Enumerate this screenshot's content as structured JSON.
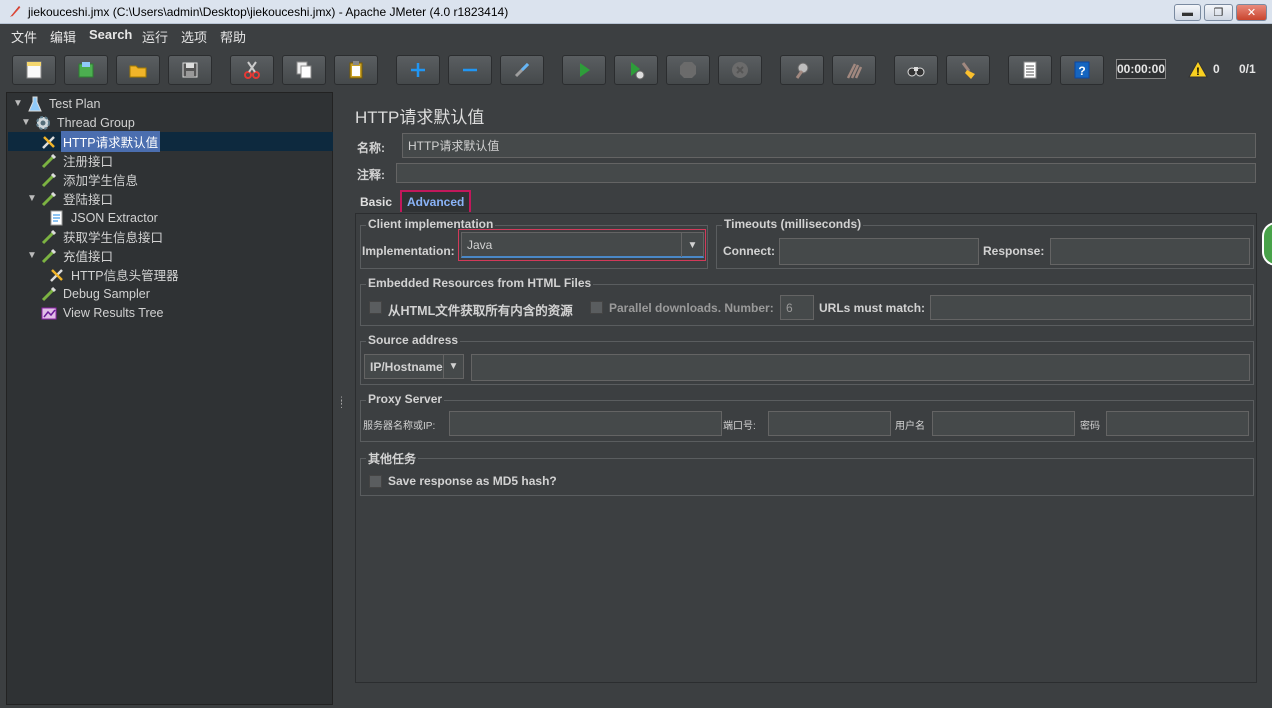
{
  "window": {
    "title": "jiekouceshi.jmx (C:\\Users\\admin\\Desktop\\jiekouceshi.jmx) - Apache JMeter (4.0 r1823414)",
    "minimize": "▬",
    "restore": "❐",
    "close": "✕"
  },
  "menu": [
    "文件",
    "编辑",
    "Search",
    "运行",
    "选项",
    "帮助"
  ],
  "toolbar": {
    "timer": "00:00:00",
    "warnings": "0",
    "threads": "0/1"
  },
  "tree": [
    {
      "label": "Test Plan"
    },
    {
      "label": "Thread Group"
    },
    {
      "label": "HTTP请求默认值"
    },
    {
      "label": "注册接口"
    },
    {
      "label": "添加学生信息"
    },
    {
      "label": "登陆接口"
    },
    {
      "label": "JSON Extractor"
    },
    {
      "label": "获取学生信息接口"
    },
    {
      "label": "充值接口"
    },
    {
      "label": "HTTP信息头管理器"
    },
    {
      "label": "Debug Sampler"
    },
    {
      "label": "View Results Tree"
    }
  ],
  "panel": {
    "title": "HTTP请求默认值",
    "name_label": "名称:",
    "name_value": "HTTP请求默认值",
    "comment_label": "注释:",
    "tabs": [
      "Basic",
      "Advanced"
    ],
    "client": {
      "title": "Client implementation",
      "impl_label": "Implementation:",
      "impl_value": "Java"
    },
    "timeouts": {
      "title": "Timeouts (milliseconds)",
      "connect_label": "Connect:",
      "response_label": "Response:"
    },
    "embedded": {
      "title": "Embedded Resources from HTML Files",
      "retrieve_label": "从HTML文件获取所有内含的资源",
      "parallel_label": "Parallel downloads. Number:",
      "parallel_value": "6",
      "urls_label": "URLs must match:"
    },
    "source": {
      "title": "Source address",
      "type_value": "IP/Hostname"
    },
    "proxy": {
      "title": "Proxy Server",
      "server_label": "服务器名称或IP:",
      "port_label": "端口号:",
      "user_label": "用户名",
      "pass_label": "密码"
    },
    "other": {
      "title": "其他任务",
      "md5_label": "Save response as MD5 hash?"
    }
  }
}
